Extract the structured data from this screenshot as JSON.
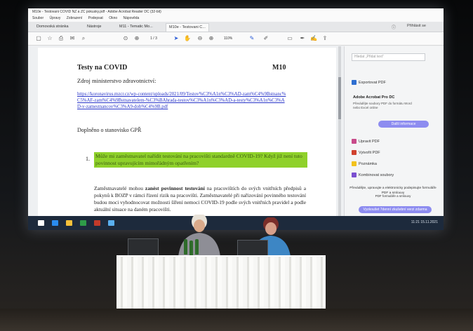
{
  "window": {
    "title": "M10e - Testovani COVID NZ a ZC pokusky.pdf - Adobe Acrobat Reader DC (32-bit)",
    "menu": [
      "Soubor",
      "Úpravy",
      "Zobrazení",
      "Podepsat",
      "Okno",
      "Nápověda"
    ]
  },
  "tabs": {
    "home": "Domovská stránka",
    "tools": "Nástroje",
    "doc1": "M11 - Tematic Mo...",
    "doc2": "M10e - Testovani C...",
    "signin": "Přihlásit se",
    "help_icon": "question-icon"
  },
  "toolbar": {
    "page": "1 / 3",
    "zoom": "110%",
    "tools": [
      "file-icon",
      "star-icon",
      "print-icon",
      "mail-icon",
      "search-icon",
      "upload-icon",
      "download-icon",
      "cursor-icon",
      "hand-icon",
      "zoom-out-icon",
      "zoom-in-icon",
      "comment-icon",
      "pen-icon",
      "sign-icon",
      "share-icon"
    ]
  },
  "document": {
    "title": "Testy na COVID",
    "code": "M10",
    "source": "Zdroj ministerstvo zdravotnictví:",
    "link": "https://koronavirus.mzcr.cz/wp-content/uploads/2021/09/Testov%C3%A1n%C3%AD-zam%C4%9Bstnanc%C5%AF-zam%C4%9Bstnavatelem-%C3%BAhrada-testov%C3%A1n%C3%AD-a-testy%C3%A1n%C3%AD-v-zamestnancov%C3%A9-dob%C4%9B.pdf",
    "note": "Doplněno o stanovisko GPŘ",
    "list_number": "1.",
    "highlight": "Může mi zaměstnavatel nařídit testování na pracovišti standardně COVID-19? Když již není tuto povinnost upravujícím mimořádným opatřením?",
    "body_parts": [
      "Zaměstnavatelé mohou ",
      "zanést povinnost testování",
      " na pracovištích do svých vnitřních předpisů a pokynů k BOZP v rámci řízení rizik na pracovišti. Zaměstnavatelé při nařizování povinného testování budou moci vyhodnocovat možnosti šíření nemoci COVID-19 podle svých vnitřních pravidel a podle aktuální situace na daném pracovišti."
    ]
  },
  "right_pane": {
    "search_placeholder": "Hledat „Přidat text“",
    "export": "Exportovat PDF",
    "pro_title": "Adobe Acrobat Pro DC",
    "pro_text": "Převádějte soubory PDF do formátu Word nebo Excel online",
    "pro_button": "Další informace",
    "edit": "Upravit PDF",
    "create": "Vytvořit PDF",
    "comment": "Poznámka",
    "combine": "Kombinovat soubory",
    "footer": "Převádějte, upravujte a elektronicky podepisujte formuláře PDF a smlouvy",
    "footer2": "PDF formuláře a smlouvy",
    "trial_button": "Vyzkoušet 7denní zkušební verzi zdarma"
  },
  "taskbar": {
    "time": "11:21",
    "date": "15.11.2021",
    "icon_colors": [
      "#ffffff",
      "#2a8cf0",
      "#f5c03a",
      "#2e9b48",
      "#c23a2a",
      "#5ab0f0"
    ]
  }
}
